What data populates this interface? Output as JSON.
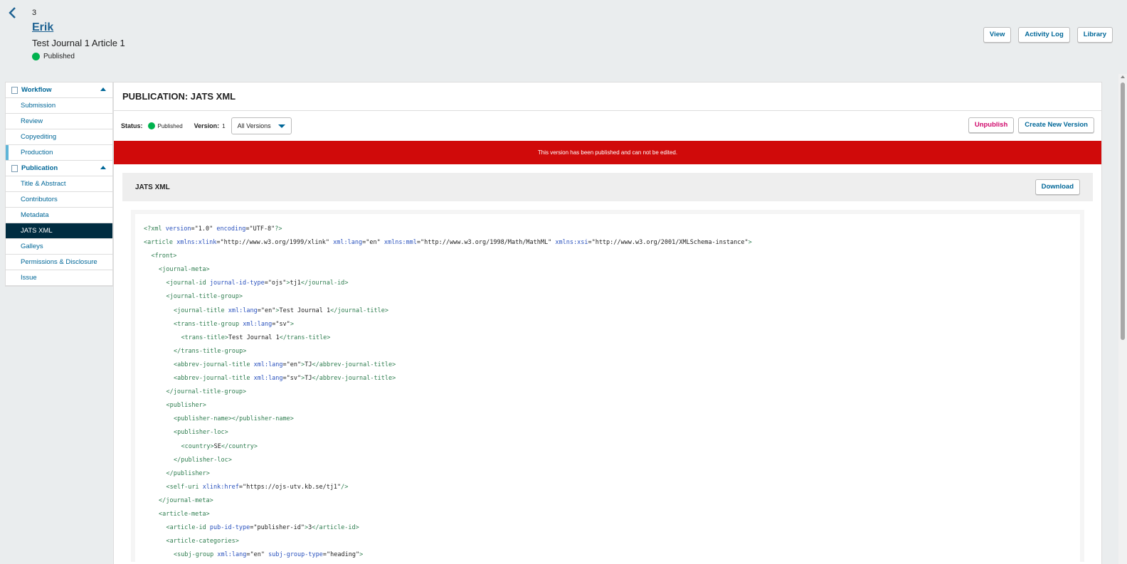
{
  "header": {
    "submission_id": "3",
    "author": "Erik",
    "title": "Test Journal 1 Article 1",
    "status": "Published",
    "buttons": {
      "view": "View",
      "activity_log": "Activity Log",
      "library": "Library"
    }
  },
  "sidebar": {
    "workflow": {
      "label": "Workflow",
      "items": [
        "Submission",
        "Review",
        "Copyediting",
        "Production"
      ]
    },
    "publication": {
      "label": "Publication",
      "items": [
        "Title & Abstract",
        "Contributors",
        "Metadata",
        "JATS XML",
        "Galleys",
        "Permissions & Disclosure",
        "Issue"
      ]
    }
  },
  "main": {
    "title": "PUBLICATION: JATS XML",
    "status_label": "Status:",
    "status_value": "Published",
    "version_label": "Version:",
    "version_value": "1",
    "version_select": "All Versions",
    "unpublish": "Unpublish",
    "create_new_version": "Create New Version",
    "alert": "This version has been published and can not be edited.",
    "panel_title": "JATS XML",
    "download": "Download"
  },
  "colors": {
    "accent": "#006798",
    "alert": "#d00a0a",
    "active_nav": "#002c40",
    "published_dot": "#00b24e",
    "unpublish": "#d00a6c"
  },
  "code_lines": [
    [
      0,
      "<?xml version=\"1.0\" encoding=\"UTF-8\"?>"
    ],
    [
      0,
      "<article xmlns:xlink=\"http://www.w3.org/1999/xlink\" xml:lang=\"en\" xmlns:mml=\"http://www.w3.org/1998/Math/MathML\" xmlns:xsi=\"http://www.w3.org/2001/XMLSchema-instance\">"
    ],
    [
      1,
      "<front>"
    ],
    [
      2,
      "<journal-meta>"
    ],
    [
      3,
      "<journal-id journal-id-type=\"ojs\">tj1</journal-id>"
    ],
    [
      3,
      "<journal-title-group>"
    ],
    [
      4,
      "<journal-title xml:lang=\"en\">Test Journal 1</journal-title>"
    ],
    [
      4,
      "<trans-title-group xml:lang=\"sv\">"
    ],
    [
      5,
      "<trans-title>Test Journal 1</trans-title>"
    ],
    [
      4,
      "</trans-title-group>"
    ],
    [
      4,
      "<abbrev-journal-title xml:lang=\"en\">TJ</abbrev-journal-title>"
    ],
    [
      4,
      "<abbrev-journal-title xml:lang=\"sv\">TJ</abbrev-journal-title>"
    ],
    [
      3,
      "</journal-title-group>"
    ],
    [
      3,
      "<publisher>"
    ],
    [
      4,
      "<publisher-name></publisher-name>"
    ],
    [
      4,
      "<publisher-loc>"
    ],
    [
      5,
      "<country>SE</country>"
    ],
    [
      4,
      "</publisher-loc>"
    ],
    [
      3,
      "</publisher>"
    ],
    [
      3,
      "<self-uri xlink:href=\"https://ojs-utv.kb.se/tj1\"/>"
    ],
    [
      2,
      "</journal-meta>"
    ],
    [
      2,
      "<article-meta>"
    ],
    [
      3,
      "<article-id pub-id-type=\"publisher-id\">3</article-id>"
    ],
    [
      3,
      "<article-categories>"
    ],
    [
      4,
      "<subj-group xml:lang=\"en\" subj-group-type=\"heading\">"
    ]
  ]
}
